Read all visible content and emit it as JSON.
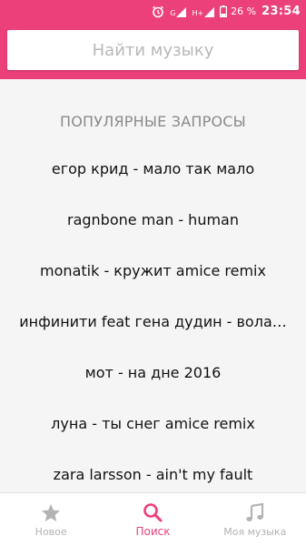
{
  "status_bar": {
    "network_label": "G",
    "network_label_2": "H+",
    "battery": "26 %",
    "time": "23:54"
  },
  "search": {
    "placeholder": "Найти музыку"
  },
  "popular": {
    "title": "ПОПУЛЯРНЫЕ ЗАПРОСЫ",
    "items": [
      "егор крид - мало так мало",
      "ragnbone man - human",
      "monatik - кружит amice remix",
      "инфинити feat гена дудин - вола…",
      "мот - на дне 2016",
      "луна - ты снег amice remix",
      "zara larsson - ain't my fault"
    ]
  },
  "bottom_nav": {
    "items": [
      {
        "label": "Новое",
        "icon": "star-icon",
        "active": false
      },
      {
        "label": "Поиск",
        "icon": "search-icon",
        "active": true
      },
      {
        "label": "Моя музыка",
        "icon": "music-note-icon",
        "active": false
      }
    ]
  },
  "colors": {
    "accent": "#ec407a",
    "inactive": "#b3b3b3",
    "background": "#f5f5f5"
  }
}
